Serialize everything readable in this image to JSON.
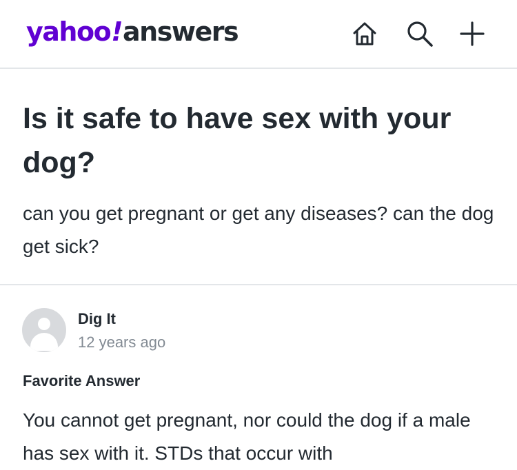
{
  "header": {
    "logo": {
      "brand": "yahoo",
      "bang": "!",
      "product": "answers"
    },
    "icons": [
      "home-icon",
      "search-icon",
      "plus-icon"
    ]
  },
  "question": {
    "title": "Is it safe to have sex with your dog?",
    "body": "can you get pregnant or get any diseases? can the dog get sick?"
  },
  "answer": {
    "author": "Dig It",
    "timestamp": "12 years ago",
    "label": "Favorite Answer",
    "text": "You cannot get pregnant, nor could the dog if a male has sex with it. STDs that occur with"
  },
  "colors": {
    "brand": "#6001d2",
    "text": "#232a31",
    "muted": "#828a93",
    "divider": "#e3e6e9",
    "avatar": "#d8dadd"
  }
}
